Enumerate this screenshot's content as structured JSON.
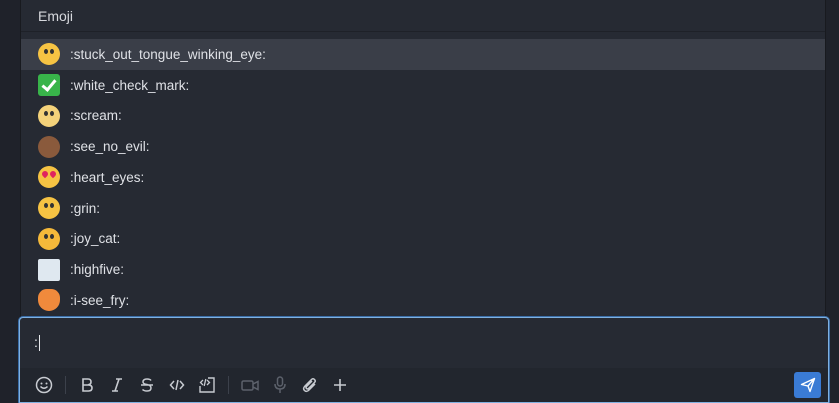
{
  "popup": {
    "title": "Emoji"
  },
  "emoji_list": [
    {
      "code": ":stuck_out_tongue_winking_eye:",
      "icon": "stuck-out-tongue-winking-eye-icon",
      "selected": true
    },
    {
      "code": ":white_check_mark:",
      "icon": "white-check-mark-icon",
      "selected": false
    },
    {
      "code": ":scream:",
      "icon": "scream-icon",
      "selected": false
    },
    {
      "code": ":see_no_evil:",
      "icon": "see-no-evil-icon",
      "selected": false
    },
    {
      "code": ":heart_eyes:",
      "icon": "heart-eyes-icon",
      "selected": false
    },
    {
      "code": ":grin:",
      "icon": "grin-icon",
      "selected": false
    },
    {
      "code": ":joy_cat:",
      "icon": "joy-cat-icon",
      "selected": false
    },
    {
      "code": ":highfive:",
      "icon": "highfive-icon",
      "selected": false
    },
    {
      "code": ":i-see_fry:",
      "icon": "i-see-fry-icon",
      "selected": false
    }
  ],
  "composer": {
    "value": ":",
    "toolbar": [
      "emoji-icon",
      "bold-icon",
      "italic-icon",
      "strikethrough-icon",
      "inline-code-icon",
      "code-block-icon",
      "video-icon",
      "microphone-icon",
      "attachment-icon",
      "plus-icon"
    ],
    "send": "send-icon"
  },
  "colors": {
    "accent": "#3a7bd5",
    "focus_border": "#7fb0e0",
    "selected_row": "#3a3e48"
  }
}
